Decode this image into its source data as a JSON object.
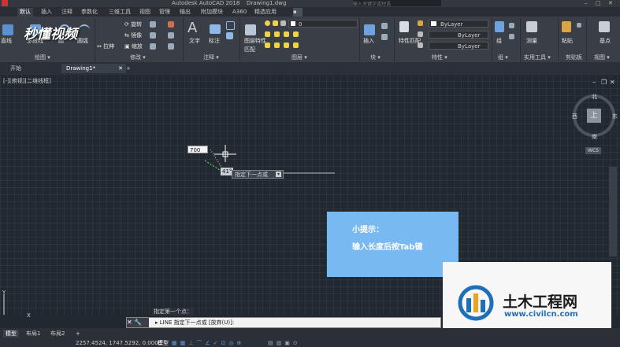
{
  "title": {
    "app": "Autodesk AutoCAD 2018",
    "file": "Drawing1.dwg",
    "search_placeholder": "输入关键字或短语"
  },
  "ribbon_tabs": [
    "默认",
    "插入",
    "注释",
    "参数化",
    "三维工具",
    "视图",
    "管理",
    "输出",
    "附加模块",
    "A360",
    "精选应用"
  ],
  "panel_titles": {
    "draw": "绘图",
    "modify": "修改",
    "annotation": "注释",
    "layers": "图层",
    "block": "块",
    "properties": "特性",
    "groups": "组",
    "utilities": "实用工具",
    "clipboard": "剪贴板",
    "view": "视图"
  },
  "ribbon_labels": {
    "line": "直线",
    "polyline": "多段线",
    "circle": "圆",
    "arc": "圆弧",
    "rotate": "旋转",
    "mirror": "镜像",
    "stretch": "拉伸",
    "scale": "缩放",
    "text": "文字",
    "dimension": "标注",
    "layer_props": "图层特性",
    "layer_match": "匹配",
    "insert": "插入",
    "match_props": "特性匹配",
    "group": "组",
    "measure": "测量",
    "paste": "粘贴",
    "base": "基点",
    "layer_value": "0"
  },
  "properties_values": [
    "ByLayer",
    "ByLayer",
    "ByLayer"
  ],
  "doc_tabs": [
    "开始",
    "Drawing1*"
  ],
  "viewport_label": "[-][俯视][二维线框]",
  "compass": {
    "north": "北",
    "south": "南",
    "east": "东",
    "west": "西",
    "top": "上",
    "wcs": "WCS"
  },
  "dynamic_input": {
    "length": "700",
    "angle": "41°",
    "prompt": "指定下一点或"
  },
  "hint": {
    "title": "小提示：",
    "body": "输入长度后按Tab键"
  },
  "command": {
    "history": "指定第一个点：",
    "current": "LINE 指定下一点或 [放弃(U)]:"
  },
  "layout_tabs": [
    "模型",
    "布局1",
    "布局2"
  ],
  "coords": "2257.4524, 1747.5292, 0.0000",
  "status_mode": "模型",
  "watermark": {
    "name": "土木工程网",
    "url": "www.civilcn.com",
    "logo": "秒懂视频"
  }
}
